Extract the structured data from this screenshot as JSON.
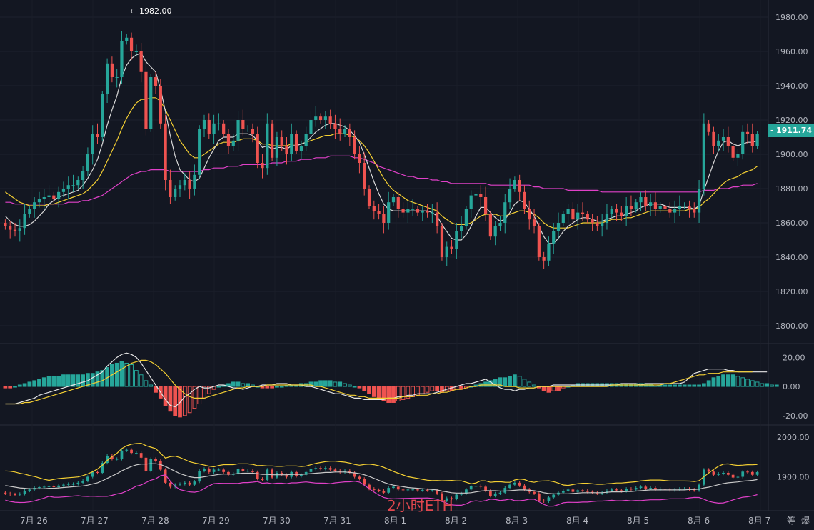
{
  "chart_data": [
    {
      "type": "candlestick",
      "title": "",
      "overlay": "2小时ETH",
      "ylim": [
        1790,
        1990
      ],
      "y_ticks": [
        "1800.00",
        "1820.00",
        "1840.00",
        "1860.00",
        "1880.00",
        "1900.00",
        "1920.00",
        "1940.00",
        "1960.00",
        "1980.00"
      ],
      "x_ticks": [
        "7月 26",
        "7月 27",
        "7月 28",
        "7月 29",
        "7月 30",
        "7月 31",
        "8月 1",
        "8月 2",
        "8月 3",
        "8月 4",
        "8月 5",
        "8月 6",
        "8月 7"
      ],
      "last_price": "1911.74",
      "high_marker": "1982.00",
      "closes": [
        1858,
        1856,
        1855,
        1857,
        1865,
        1868,
        1872,
        1874,
        1875,
        1876,
        1874,
        1878,
        1880,
        1882,
        1882,
        1885,
        1890,
        1900,
        1912,
        1910,
        1935,
        1953,
        1945,
        1945,
        1966,
        1968,
        1960,
        1960,
        1948,
        1915,
        1945,
        1940,
        1918,
        1885,
        1875,
        1880,
        1882,
        1885,
        1880,
        1888,
        1915,
        1920,
        1912,
        1918,
        1918,
        1912,
        1905,
        1908,
        1920,
        1915,
        1915,
        1912,
        1895,
        1892,
        1918,
        1898,
        1910,
        1905,
        1900,
        1912,
        1902,
        1905,
        1912,
        1920,
        1922,
        1920,
        1922,
        1918,
        1915,
        1912,
        1915,
        1910,
        1900,
        1895,
        1880,
        1870,
        1867,
        1865,
        1860,
        1872,
        1875,
        1868,
        1866,
        1868,
        1868,
        1866,
        1867,
        1866,
        1866,
        1858,
        1840,
        1846,
        1845,
        1855,
        1858,
        1868,
        1876,
        1877,
        1875,
        1865,
        1852,
        1858,
        1860,
        1872,
        1880,
        1885,
        1878,
        1868,
        1862,
        1858,
        1840,
        1838,
        1848,
        1855,
        1860,
        1865,
        1868,
        1862,
        1866,
        1865,
        1862,
        1860,
        1858,
        1860,
        1865,
        1868,
        1866,
        1864,
        1870,
        1868,
        1872,
        1875,
        1870,
        1872,
        1868,
        1870,
        1868,
        1866,
        1868,
        1870,
        1870,
        1868,
        1866,
        1880,
        1918,
        1913,
        1905,
        1908,
        1910,
        1905,
        1898,
        1900,
        1913,
        1912,
        1905,
        1911.74
      ],
      "ma_short": [
        1864,
        1861,
        1859,
        1858,
        1858,
        1859,
        1861,
        1864,
        1867,
        1871,
        1873,
        1875,
        1876,
        1877,
        1878,
        1879,
        1882,
        1886,
        1891,
        1897,
        1906,
        1917,
        1926,
        1934,
        1945,
        1952,
        1956,
        1958,
        1959,
        1954,
        1951,
        1948,
        1938,
        1925,
        1911,
        1899,
        1891,
        1888,
        1885,
        1884,
        1886,
        1892,
        1898,
        1903,
        1908,
        1910,
        1910,
        1910,
        1912,
        1912,
        1912,
        1911,
        1908,
        1904,
        1905,
        1903,
        1904,
        1904,
        1903,
        1905,
        1905,
        1906,
        1907,
        1910,
        1913,
        1915,
        1917,
        1918,
        1918,
        1917,
        1916,
        1914,
        1911,
        1907,
        1900,
        1892,
        1884,
        1877,
        1871,
        1868,
        1867,
        1867,
        1867,
        1867,
        1867,
        1867,
        1867,
        1867,
        1866,
        1864,
        1859,
        1855,
        1851,
        1850,
        1850,
        1853,
        1858,
        1864,
        1869,
        1869,
        1866,
        1863,
        1861,
        1862,
        1866,
        1871,
        1873,
        1872,
        1868,
        1864,
        1858,
        1852,
        1848,
        1848,
        1851,
        1855,
        1858,
        1860,
        1862,
        1863,
        1863,
        1862,
        1861,
        1861,
        1862,
        1863,
        1864,
        1864,
        1865,
        1866,
        1867,
        1869,
        1870,
        1871,
        1871,
        1871,
        1870,
        1869,
        1869,
        1869,
        1869,
        1869,
        1868,
        1870,
        1879,
        1887,
        1895,
        1902,
        1907,
        1908,
        1906,
        1905,
        1906,
        1907,
        1907,
        1908
      ],
      "ma_mid": [
        1878,
        1876,
        1874,
        1872,
        1871,
        1870,
        1870,
        1870,
        1870,
        1871,
        1871,
        1872,
        1873,
        1874,
        1875,
        1876,
        1877,
        1879,
        1882,
        1885,
        1890,
        1896,
        1902,
        1908,
        1915,
        1921,
        1926,
        1930,
        1932,
        1932,
        1933,
        1933,
        1931,
        1926,
        1920,
        1914,
        1908,
        1904,
        1900,
        1898,
        1898,
        1900,
        1902,
        1904,
        1906,
        1907,
        1907,
        1907,
        1908,
        1909,
        1909,
        1909,
        1908,
        1906,
        1906,
        1905,
        1905,
        1905,
        1905,
        1906,
        1906,
        1906,
        1907,
        1908,
        1909,
        1910,
        1911,
        1911,
        1912,
        1912,
        1912,
        1911,
        1910,
        1908,
        1905,
        1901,
        1896,
        1891,
        1886,
        1882,
        1879,
        1877,
        1875,
        1873,
        1872,
        1871,
        1870,
        1869,
        1868,
        1867,
        1864,
        1862,
        1860,
        1859,
        1859,
        1859,
        1860,
        1862,
        1864,
        1865,
        1865,
        1865,
        1864,
        1864,
        1865,
        1866,
        1867,
        1867,
        1866,
        1865,
        1863,
        1860,
        1858,
        1857,
        1857,
        1857,
        1857,
        1858,
        1859,
        1860,
        1860,
        1860,
        1860,
        1860,
        1861,
        1862,
        1862,
        1862,
        1863,
        1863,
        1864,
        1865,
        1866,
        1867,
        1867,
        1867,
        1867,
        1867,
        1867,
        1867,
        1867,
        1868,
        1868,
        1869,
        1872,
        1874,
        1877,
        1880,
        1883,
        1885,
        1886,
        1887,
        1889,
        1890,
        1891,
        1893
      ],
      "ma_long": [
        1872,
        1872,
        1871,
        1871,
        1871,
        1871,
        1871,
        1871,
        1871,
        1871,
        1871,
        1871,
        1871,
        1872,
        1872,
        1872,
        1873,
        1873,
        1874,
        1875,
        1876,
        1878,
        1880,
        1882,
        1884,
        1886,
        1888,
        1889,
        1890,
        1890,
        1891,
        1891,
        1891,
        1891,
        1890,
        1890,
        1890,
        1890,
        1890,
        1890,
        1890,
        1891,
        1891,
        1892,
        1892,
        1892,
        1893,
        1893,
        1893,
        1894,
        1894,
        1894,
        1894,
        1894,
        1894,
        1895,
        1895,
        1895,
        1896,
        1896,
        1896,
        1897,
        1897,
        1897,
        1898,
        1898,
        1898,
        1899,
        1899,
        1899,
        1899,
        1899,
        1898,
        1898,
        1897,
        1896,
        1895,
        1893,
        1892,
        1891,
        1890,
        1889,
        1888,
        1887,
        1887,
        1886,
        1886,
        1886,
        1885,
        1885,
        1884,
        1884,
        1883,
        1883,
        1883,
        1883,
        1883,
        1883,
        1883,
        1883,
        1882,
        1882,
        1882,
        1882,
        1882,
        1882,
        1882,
        1882,
        1882,
        1881,
        1881,
        1880,
        1880,
        1880,
        1880,
        1880,
        1879,
        1879,
        1879,
        1879,
        1879,
        1879,
        1879,
        1878,
        1878,
        1878,
        1878,
        1878,
        1878,
        1878,
        1878,
        1878,
        1878,
        1878,
        1878,
        1878,
        1878,
        1878,
        1878,
        1878,
        1878,
        1878,
        1878,
        1878,
        1879,
        1879,
        1879,
        1880,
        1880,
        1880,
        1881,
        1881,
        1882,
        1882,
        1882,
        1883
      ]
    },
    {
      "type": "macd",
      "ylim": [
        -25,
        28
      ],
      "y_ticks": [
        "20.00",
        "0.00",
        "-20.00"
      ],
      "histogram": [
        -1,
        -1,
        0,
        1,
        2,
        3,
        4,
        5,
        6,
        7,
        7,
        7,
        8,
        8,
        8,
        8,
        8,
        9,
        9,
        10,
        11,
        13,
        15,
        16,
        17,
        16,
        15,
        11,
        8,
        4,
        1,
        -4,
        -8,
        -13,
        -17,
        -20,
        -21,
        -20,
        -18,
        -15,
        -12,
        -8,
        -5,
        -2,
        0,
        1,
        2,
        3,
        3,
        2,
        2,
        1,
        0,
        -1,
        -1,
        -1,
        0,
        0,
        1,
        1,
        1,
        2,
        2,
        3,
        3,
        4,
        4,
        4,
        3,
        3,
        2,
        1,
        0,
        -1,
        -3,
        -5,
        -7,
        -9,
        -10,
        -11,
        -11,
        -10,
        -9,
        -8,
        -7,
        -6,
        -5,
        -4,
        -3,
        -3,
        -4,
        -3,
        -3,
        -2,
        -2,
        -1,
        0,
        1,
        2,
        3,
        4,
        5,
        6,
        6,
        7,
        8,
        7,
        5,
        3,
        1,
        -1,
        -3,
        -4,
        -3,
        -3,
        -1,
        0,
        1,
        2,
        2,
        2,
        2,
        2,
        2,
        2,
        2,
        2,
        2,
        2,
        2,
        2,
        2,
        2,
        2,
        1,
        1,
        1,
        1,
        1,
        1,
        1,
        1,
        1,
        1,
        2,
        4,
        6,
        7,
        8,
        8,
        8,
        7,
        6,
        5,
        4,
        3,
        2,
        2,
        1,
        1
      ],
      "macd_line": [
        -12,
        -12,
        -12,
        -11,
        -10,
        -9,
        -8,
        -6,
        -5,
        -4,
        -3,
        -2,
        -1,
        0,
        1,
        2,
        3,
        4,
        6,
        8,
        10,
        14,
        17,
        20,
        22,
        23,
        22,
        20,
        16,
        11,
        6,
        1,
        -4,
        -9,
        -13,
        -14,
        -11,
        -7,
        -5,
        -2,
        0,
        -1,
        -1,
        0,
        1,
        1,
        0,
        -1,
        -1,
        -2,
        -1,
        0,
        0,
        1,
        1,
        1,
        2,
        2,
        2,
        1,
        1,
        1,
        0,
        0,
        -1,
        -2,
        -3,
        -4,
        -5,
        -5,
        -6,
        -7,
        -8,
        -8,
        -9,
        -9,
        -9,
        -9,
        -9,
        -8,
        -8,
        -7,
        -7,
        -6,
        -6,
        -5,
        -5,
        -5,
        -5,
        -4,
        -3,
        -2,
        -1,
        0,
        1,
        2,
        2,
        3,
        4,
        5,
        3,
        1,
        -1,
        -2,
        -2,
        -3,
        -2,
        -2,
        -1,
        -1,
        0,
        0,
        0,
        1,
        1,
        1,
        1,
        1,
        1,
        1,
        1,
        1,
        1,
        1,
        1,
        1,
        1,
        2,
        2,
        2,
        2,
        1,
        2,
        2,
        2,
        2,
        2,
        2,
        2,
        2,
        3,
        6,
        9,
        10,
        11,
        12,
        12,
        12,
        12,
        11,
        11,
        10,
        10,
        10,
        10,
        10,
        10,
        10
      ],
      "signal_line": [
        -12,
        -12,
        -12,
        -12,
        -11,
        -11,
        -10,
        -9,
        -8,
        -7,
        -6,
        -5,
        -4,
        -3,
        -2,
        -1,
        0,
        1,
        2,
        3,
        4,
        6,
        8,
        10,
        12,
        14,
        16,
        17,
        18,
        18,
        17,
        15,
        12,
        9,
        5,
        1,
        -2,
        -5,
        -7,
        -8,
        -8,
        -8,
        -7,
        -6,
        -5,
        -4,
        -3,
        -2,
        -1,
        -1,
        0,
        0,
        0,
        0,
        1,
        1,
        1,
        1,
        1,
        1,
        1,
        1,
        1,
        1,
        0,
        0,
        -1,
        -2,
        -3,
        -4,
        -5,
        -6,
        -6,
        -7,
        -7,
        -8,
        -8,
        -8,
        -8,
        -8,
        -8,
        -8,
        -7,
        -7,
        -7,
        -6,
        -6,
        -6,
        -5,
        -5,
        -4,
        -4,
        -3,
        -2,
        -2,
        -1,
        0,
        0,
        1,
        1,
        1,
        1,
        1,
        0,
        0,
        0,
        -1,
        -1,
        -1,
        -1,
        0,
        0,
        0,
        0,
        0,
        0,
        0,
        0,
        0,
        0,
        0,
        0,
        0,
        0,
        0,
        1,
        1,
        1,
        1,
        1,
        1,
        1,
        1,
        1,
        1,
        1,
        2,
        2,
        3,
        4,
        5,
        6,
        7,
        8,
        8,
        9,
        9,
        9,
        10,
        10,
        10,
        10,
        10,
        10,
        10
      ]
    },
    {
      "type": "bollinger",
      "ylim": [
        1820,
        2025
      ],
      "y_ticks": [
        "2000.00",
        "1900.00"
      ]
    }
  ],
  "ui": {
    "bottom_right_icons": [
      "等",
      "爆"
    ]
  }
}
